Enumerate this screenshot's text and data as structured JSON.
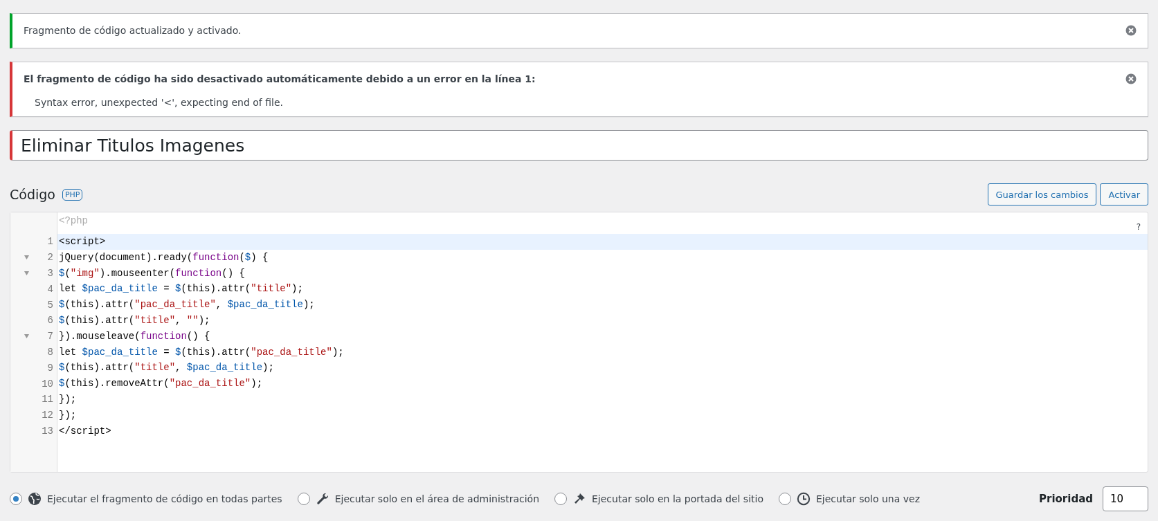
{
  "notices": [
    {
      "kind": "success",
      "message": "Fragmento de código actualizado y activado."
    },
    {
      "kind": "error",
      "message": "El fragmento de código ha sido desactivado automáticamente debido a un error en la línea 1:",
      "detail": "Syntax error, unexpected '<', expecting end of file."
    }
  ],
  "snippet_title": {
    "value": "Eliminar Titulos Imagenes"
  },
  "code_section": {
    "heading": "Código",
    "badge": "PHP",
    "buttons": [
      "Guardar los cambios",
      "Activar"
    ]
  },
  "editor": {
    "prefix": "<?php",
    "help": "?",
    "lines": [
      {
        "number": "1",
        "active": true,
        "foldable": false,
        "tokens": [
          {
            "kind": "plain",
            "text": "<script>"
          }
        ]
      },
      {
        "number": "2",
        "active": false,
        "foldable": true,
        "tokens": [
          {
            "kind": "plain",
            "text": "jQuery(document).ready("
          },
          {
            "kind": "keyword",
            "text": "function"
          },
          {
            "kind": "plain",
            "text": "("
          },
          {
            "kind": "variable",
            "text": "$"
          },
          {
            "kind": "plain",
            "text": ") {"
          }
        ]
      },
      {
        "number": "3",
        "active": false,
        "foldable": true,
        "tokens": [
          {
            "kind": "variable",
            "text": "$"
          },
          {
            "kind": "plain",
            "text": "("
          },
          {
            "kind": "string",
            "text": "\"img\""
          },
          {
            "kind": "plain",
            "text": ").mouseenter("
          },
          {
            "kind": "keyword",
            "text": "function"
          },
          {
            "kind": "plain",
            "text": "() {"
          }
        ]
      },
      {
        "number": "4",
        "active": false,
        "foldable": false,
        "tokens": [
          {
            "kind": "plain",
            "text": "let "
          },
          {
            "kind": "variable",
            "text": "$pac_da_title"
          },
          {
            "kind": "plain",
            "text": " = "
          },
          {
            "kind": "variable",
            "text": "$"
          },
          {
            "kind": "plain",
            "text": "(this).attr("
          },
          {
            "kind": "string",
            "text": "\"title\""
          },
          {
            "kind": "plain",
            "text": ");"
          }
        ]
      },
      {
        "number": "5",
        "active": false,
        "foldable": false,
        "tokens": [
          {
            "kind": "variable",
            "text": "$"
          },
          {
            "kind": "plain",
            "text": "(this).attr("
          },
          {
            "kind": "string",
            "text": "\"pac_da_title\""
          },
          {
            "kind": "plain",
            "text": ", "
          },
          {
            "kind": "variable",
            "text": "$pac_da_title"
          },
          {
            "kind": "plain",
            "text": ");"
          }
        ]
      },
      {
        "number": "6",
        "active": false,
        "foldable": false,
        "tokens": [
          {
            "kind": "variable",
            "text": "$"
          },
          {
            "kind": "plain",
            "text": "(this).attr("
          },
          {
            "kind": "string",
            "text": "\"title\""
          },
          {
            "kind": "plain",
            "text": ", "
          },
          {
            "kind": "string",
            "text": "\"\""
          },
          {
            "kind": "plain",
            "text": ");"
          }
        ]
      },
      {
        "number": "7",
        "active": false,
        "foldable": true,
        "tokens": [
          {
            "kind": "plain",
            "text": "}).mouseleave("
          },
          {
            "kind": "keyword",
            "text": "function"
          },
          {
            "kind": "plain",
            "text": "() {"
          }
        ]
      },
      {
        "number": "8",
        "active": false,
        "foldable": false,
        "tokens": [
          {
            "kind": "plain",
            "text": "let "
          },
          {
            "kind": "variable",
            "text": "$pac_da_title"
          },
          {
            "kind": "plain",
            "text": " = "
          },
          {
            "kind": "variable",
            "text": "$"
          },
          {
            "kind": "plain",
            "text": "(this).attr("
          },
          {
            "kind": "string",
            "text": "\"pac_da_title\""
          },
          {
            "kind": "plain",
            "text": ");"
          }
        ]
      },
      {
        "number": "9",
        "active": false,
        "foldable": false,
        "tokens": [
          {
            "kind": "variable",
            "text": "$"
          },
          {
            "kind": "plain",
            "text": "(this).attr("
          },
          {
            "kind": "string",
            "text": "\"title\""
          },
          {
            "kind": "plain",
            "text": ", "
          },
          {
            "kind": "variable",
            "text": "$pac_da_title"
          },
          {
            "kind": "plain",
            "text": ");"
          }
        ]
      },
      {
        "number": "10",
        "active": false,
        "foldable": false,
        "tokens": [
          {
            "kind": "variable",
            "text": "$"
          },
          {
            "kind": "plain",
            "text": "(this).removeAttr("
          },
          {
            "kind": "string",
            "text": "\"pac_da_title\""
          },
          {
            "kind": "plain",
            "text": ");"
          }
        ]
      },
      {
        "number": "11",
        "active": false,
        "foldable": false,
        "tokens": [
          {
            "kind": "plain",
            "text": "});"
          }
        ]
      },
      {
        "number": "12",
        "active": false,
        "foldable": false,
        "tokens": [
          {
            "kind": "plain",
            "text": "});"
          }
        ]
      },
      {
        "number": "13",
        "active": false,
        "foldable": false,
        "tokens": [
          {
            "kind": "plain",
            "text": "</script>"
          }
        ]
      }
    ]
  },
  "scope_options": [
    {
      "kind": "global",
      "label": "Ejecutar el fragmento de código en todas partes",
      "selected": true
    },
    {
      "kind": "admin",
      "label": "Ejecutar solo en el área de administración",
      "selected": false
    },
    {
      "kind": "front",
      "label": "Ejecutar solo en la portada del sitio",
      "selected": false
    },
    {
      "kind": "once",
      "label": "Ejecutar solo una vez",
      "selected": false
    }
  ],
  "priority": {
    "label": "Prioridad",
    "value": "10"
  }
}
